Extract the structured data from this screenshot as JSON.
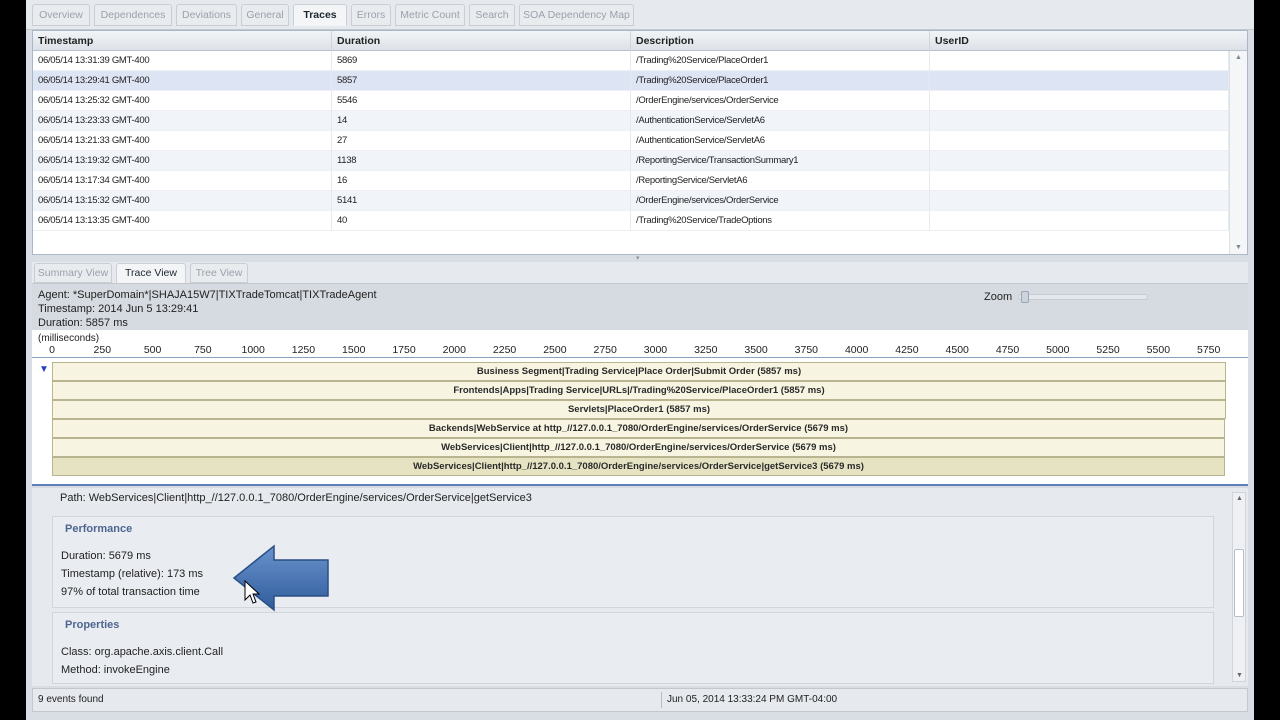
{
  "tabs": [
    {
      "label": "Overview",
      "active": false
    },
    {
      "label": "Dependences",
      "active": false
    },
    {
      "label": "Deviations",
      "active": false
    },
    {
      "label": "General",
      "active": false
    },
    {
      "label": "Traces",
      "active": true
    },
    {
      "label": "Errors",
      "active": false
    },
    {
      "label": "Metric Count",
      "active": false
    },
    {
      "label": "Search",
      "active": false
    },
    {
      "label": "SOA Dependency Map",
      "active": false
    }
  ],
  "traces_table": {
    "columns": [
      "Timestamp",
      "Duration",
      "Description",
      "UserID"
    ],
    "rows": [
      {
        "timestamp": "06/05/14 13:31:39 GMT-400",
        "duration": "5869",
        "description": "/Trading%20Service/PlaceOrder1",
        "userid": ""
      },
      {
        "timestamp": "06/05/14 13:29:41 GMT-400",
        "duration": "5857",
        "description": "/Trading%20Service/PlaceOrder1",
        "userid": ""
      },
      {
        "timestamp": "06/05/14 13:25:32 GMT-400",
        "duration": "5546",
        "description": "/OrderEngine/services/OrderService",
        "userid": ""
      },
      {
        "timestamp": "06/05/14 13:23:33 GMT-400",
        "duration": "14",
        "description": "/AuthenticationService/ServletA6",
        "userid": ""
      },
      {
        "timestamp": "06/05/14 13:21:33 GMT-400",
        "duration": "27",
        "description": "/AuthenticationService/ServletA6",
        "userid": ""
      },
      {
        "timestamp": "06/05/14 13:19:32 GMT-400",
        "duration": "1138",
        "description": "/ReportingService/TransactionSummary1",
        "userid": ""
      },
      {
        "timestamp": "06/05/14 13:17:34 GMT-400",
        "duration": "16",
        "description": "/ReportingService/ServletA6",
        "userid": ""
      },
      {
        "timestamp": "06/05/14 13:15:32 GMT-400",
        "duration": "5141",
        "description": "/OrderEngine/services/OrderService",
        "userid": ""
      },
      {
        "timestamp": "06/05/14 13:13:35 GMT-400",
        "duration": "40",
        "description": "/Trading%20Service/TradeOptions",
        "userid": ""
      }
    ]
  },
  "sub_tabs": [
    {
      "label": "Summary View",
      "active": false
    },
    {
      "label": "Trace View",
      "active": true
    },
    {
      "label": "Tree View",
      "active": false
    }
  ],
  "trace_info": {
    "agent": "Agent: *SuperDomain*|SHAJA15W7|TIXTradeTomcat|TIXTradeAgent",
    "timestamp": "Timestamp: 2014 Jun 5 13:29:41",
    "duration": "Duration: 5857 ms",
    "zoom_label": "Zoom"
  },
  "timeline": {
    "unit_label": "(milliseconds)",
    "ticks": [
      "0",
      "250",
      "500",
      "750",
      "1000",
      "1250",
      "1500",
      "1750",
      "2000",
      "2250",
      "2500",
      "2750",
      "3000",
      "3250",
      "3500",
      "3750",
      "4000",
      "4250",
      "4500",
      "4750",
      "5000",
      "5250",
      "5500",
      "5750"
    ],
    "max_ms": 5857
  },
  "trace_bars": [
    {
      "label": "Business Segment|Trading Service|Place Order|Submit Order (5857 ms)",
      "start_ms": 0,
      "duration_ms": 5857
    },
    {
      "label": "Frontends|Apps|Trading Service|URLs|/Trading%20Service/PlaceOrder1 (5857 ms)",
      "start_ms": 0,
      "duration_ms": 5857
    },
    {
      "label": "Servlets|PlaceOrder1 (5857 ms)",
      "start_ms": 0,
      "duration_ms": 5857
    },
    {
      "label": "Backends|WebService at http_//127.0.0.1_7080/OrderEngine/services/OrderService (5679 ms)",
      "start_ms": 0,
      "duration_ms": 5852
    },
    {
      "label": "WebServices|Client|http_//127.0.0.1_7080/OrderEngine/services/OrderService (5679 ms)",
      "start_ms": 0,
      "duration_ms": 5852
    },
    {
      "label": "WebServices|Client|http_//127.0.0.1_7080/OrderEngine/services/OrderService|getService3 (5679 ms)",
      "start_ms": 0,
      "duration_ms": 5852
    }
  ],
  "details": {
    "path": "Path: WebServices|Client|http_//127.0.0.1_7080/OrderEngine/services/OrderService|getService3",
    "performance": {
      "title": "Performance",
      "lines": [
        "Duration: 5679 ms",
        "Timestamp (relative): 173 ms",
        "97% of total transaction time"
      ]
    },
    "properties": {
      "title": "Properties",
      "lines": [
        "Class: org.apache.axis.client.Call",
        "Method: invokeEngine"
      ]
    }
  },
  "status": {
    "events": "9 events found",
    "datetime": "Jun 05, 2014 13:33:24 PM GMT-04:00"
  },
  "colors": {
    "highlight_arrow": "#3f6eb0",
    "bar_fill": "#f7f5e2",
    "selected_row": "#dde4f3"
  }
}
